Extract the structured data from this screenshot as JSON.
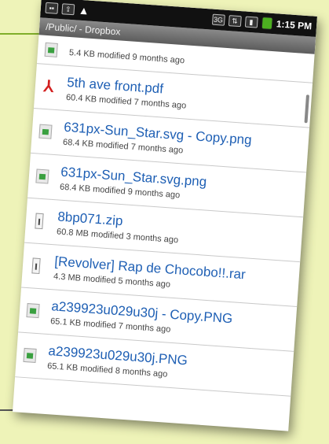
{
  "status_bar": {
    "left_icons": [
      "sd-card-icon",
      "usb-icon",
      "warning-icon"
    ],
    "right_icons": [
      "3g-icon",
      "sync-icon",
      "signal-icon",
      "battery-icon"
    ],
    "time": "1:15 PM",
    "battery_color": "#4caf20"
  },
  "title_bar": {
    "path": "/Public/ - Dropbox"
  },
  "accent_color": "#1e5fb4",
  "files": [
    {
      "name": "",
      "meta": "5.4 KB modified 9 months ago",
      "icon": "image-file-icon"
    },
    {
      "name": "5th ave front.pdf",
      "meta": "60.4 KB modified 7 months ago",
      "icon": "pdf-file-icon"
    },
    {
      "name": "631px-Sun_Star.svg - Copy.png",
      "meta": "68.4 KB modified 7 months ago",
      "icon": "image-file-icon"
    },
    {
      "name": "631px-Sun_Star.svg.png",
      "meta": "68.4 KB modified 9 months ago",
      "icon": "image-file-icon"
    },
    {
      "name": "8bp071.zip",
      "meta": "60.8 MB modified 3 months ago",
      "icon": "zip-file-icon"
    },
    {
      "name": "[Revolver] Rap de Chocobo!!.rar",
      "meta": "4.3 MB modified 5 months ago",
      "icon": "zip-file-icon"
    },
    {
      "name": "a239923u029u30j - Copy.PNG",
      "meta": "65.1 KB modified 7 months ago",
      "icon": "image-file-icon"
    },
    {
      "name": "a239923u029u30j.PNG",
      "meta": "65.1 KB modified 8 months ago",
      "icon": "image-file-icon"
    }
  ]
}
